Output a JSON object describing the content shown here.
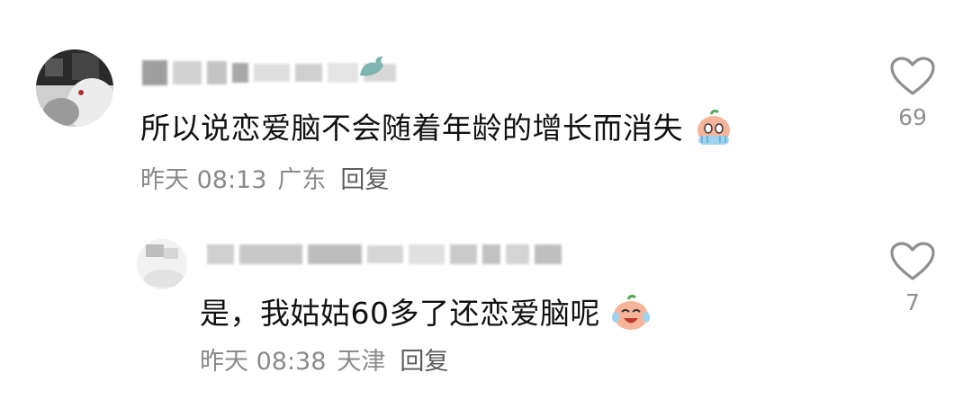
{
  "comments": [
    {
      "text": "所以说恋爱脑不会随着年龄的增长而消失",
      "emoji": "crying-face-emoji",
      "date": "昨天 08:13",
      "location": "广东",
      "reply_label": "回复",
      "likes": "69"
    },
    {
      "text": "是，我姑姑60多了还恋爱脑呢",
      "emoji": "laughing-tears-face-emoji",
      "date": "昨天 08:38",
      "location": "天津",
      "reply_label": "回复",
      "likes": "7"
    }
  ],
  "colors": {
    "text": "#111111",
    "meta": "#8a8a8a",
    "reply": "#5c5c5c",
    "icon": "#8f8f8f",
    "emoji_skin": "#f6b49a",
    "emoji_hands": "#9fd3f0"
  }
}
